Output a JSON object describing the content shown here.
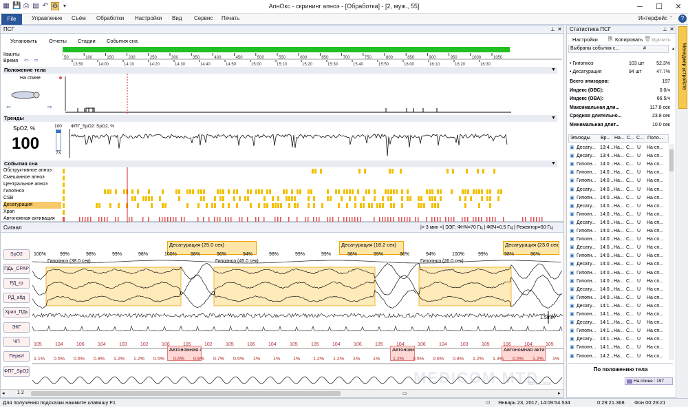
{
  "window": {
    "title": "АпнОкс - скрининг апноэ - [Обработка] - [2, муж., 55]",
    "minimize": "─",
    "maximize": "☐",
    "close": "✕"
  },
  "menu": {
    "file": "File",
    "items": [
      "Управление",
      "Съём",
      "Обработки",
      "Настройки",
      "Вид",
      "Сервис",
      "Печать"
    ],
    "interface_label": "Интерфейс",
    "help": "?"
  },
  "psg": {
    "title": "ПСГ",
    "tabs": [
      "Установить",
      "Отчеты",
      "Стадии",
      "События сна"
    ],
    "kvanty_label": "Кванты",
    "time_label": "Время",
    "stage_label": "Нет",
    "hour_ticks": [
      "13:50",
      "14:00",
      "14:10",
      "14:20",
      "14:30",
      "14:40",
      "14:50",
      "15:00",
      "15:10",
      "15:20",
      "15:30",
      "15:40",
      "15:50",
      "16:00",
      "16:10",
      "16:20",
      "16:30"
    ],
    "num_ticks": [
      "50",
      "100",
      "150",
      "200",
      "250",
      "300",
      "350",
      "400",
      "450",
      "500",
      "550",
      "600",
      "650",
      "700",
      "750",
      "800",
      "850",
      "900",
      "950",
      "1000",
      "1050"
    ],
    "position_section": "Положение тела",
    "position_value": "На спине",
    "trends_section": "Тренды",
    "spo2_label": "SpO2, %",
    "spo2_value": "100",
    "spo2_scale_top": "100",
    "spo2_scale_bottom": "73",
    "trend_title": "ФПГ_SpO2: SpO2, %",
    "events_section": "События сна",
    "event_rows": [
      "Обструктивное апноэ",
      "Смешанное апноэ",
      "Центральное апноэ",
      "Гипопноэ",
      "CSB",
      "Десатурация",
      "Храп",
      "Автономная активация"
    ]
  },
  "signal": {
    "title": "Сигнал",
    "status": "|> 3 мин <|   ЭЭГ: ФНЧ=70 Гц | ФВЧ=0.5 Гц | Режектор=50 Гц",
    "channels": [
      "SpO2",
      "ПДь_CPAP",
      "РД_гр",
      "РД_абд",
      "Храп_ПДь",
      "ЭКГ",
      "ЧП",
      "ПервИ",
      "ФПГ_SpO2"
    ],
    "desat": [
      "Десатурация (25.0 сек)",
      "Десатурация (18.2 сек)",
      "Десатурация (23.0 сек)"
    ],
    "hypo": [
      "Гипопноэ (38.0 сек)",
      "Гипопноэ (45.0 сек)",
      "Гипопноэ (26.0 сек)"
    ],
    "auton": [
      "Автономная ак",
      "Автономна",
      "Автономная актива"
    ],
    "cal": "1.5mm",
    "spo2_pcts": [
      "100%",
      "99%",
      "98%",
      "99%",
      "98%",
      "100%",
      "98%",
      "96%",
      "94%",
      "98%",
      "99%",
      "99%",
      "98%",
      "99%",
      "96%",
      "94%",
      "100%",
      "99%",
      "98%",
      "96%"
    ],
    "hr_vals": [
      "105",
      "104",
      "106",
      "104",
      "103",
      "102",
      "106",
      "105",
      "102",
      "105",
      "106",
      "104",
      "105",
      "105",
      "104",
      "106",
      "105",
      "104",
      "106",
      "104",
      "103",
      "105",
      "106",
      "104",
      "105"
    ],
    "pervi_vals": [
      "1.1%",
      "0.5%",
      "0.6%",
      "0.8%",
      "1.2%",
      "1.2%",
      "0.5%",
      "0.6%",
      "0.8%",
      "0.7%",
      "0.5%",
      "1%",
      "1%",
      "1%",
      "1.2%",
      "1.2%",
      "1%",
      "1%",
      "1.2%",
      "0.5%",
      "0.6%",
      "0.8%",
      "1.2%",
      "1.3%",
      "0.5%",
      "1.2%",
      "1%"
    ],
    "page": "1 2",
    "watermark": "MEDICOM MTD",
    "watermark_date": "Mar 12 2018"
  },
  "stats": {
    "title": "Статистика ПСГ",
    "btn_settings": "Настройки",
    "btn_copy": "Копировать",
    "btn_delete": "Удалить",
    "col_selected": "Выбраны события с...",
    "col_num": "#",
    "rows": [
      {
        "name": "Гипопноэ",
        "count": "103 шт",
        "pct": "52.3%"
      },
      {
        "name": "Десатурация",
        "count": "94 шт",
        "pct": "47.7%"
      }
    ],
    "summary": [
      {
        "label": "Всего эпизодов:",
        "value": "197"
      },
      {
        "label": "Индекс (ОВС):",
        "value": "0.0/ч"
      },
      {
        "label": "Индекс (ОВА):",
        "value": "66.5/ч"
      },
      {
        "label": "Максимальная дли...",
        "value": "117.8 сек"
      },
      {
        "label": "Средняя длительно...",
        "value": "23.8 сек"
      },
      {
        "label": "Минимальная длит...",
        "value": "10.0 сек"
      }
    ],
    "ep_cols": [
      "Эпизоды",
      "Вр...",
      "На...",
      "С...",
      "С...",
      "Поло..."
    ],
    "episodes": [
      {
        "name": "Десату...",
        "time": "13:4...",
        "na": "На...",
        "s1": "С...",
        "s2": "U",
        "pos": "На сп..."
      },
      {
        "name": "Десату...",
        "time": "13:4...",
        "na": "На...",
        "s1": "С...",
        "s2": "U",
        "pos": "На сп..."
      },
      {
        "name": "Гипопн...",
        "time": "14:0...",
        "na": "На...",
        "s1": "С...",
        "s2": "U",
        "pos": "На сп..."
      },
      {
        "name": "Гипопн...",
        "time": "14:0...",
        "na": "На...",
        "s1": "С...",
        "s2": "U",
        "pos": "На сп..."
      },
      {
        "name": "Гипопн...",
        "time": "14:0...",
        "na": "На...",
        "s1": "С...",
        "s2": "U",
        "pos": "На сп..."
      },
      {
        "name": "Десату...",
        "time": "14:0...",
        "na": "На...",
        "s1": "С...",
        "s2": "U",
        "pos": "На сп..."
      },
      {
        "name": "Гипопн...",
        "time": "14:0...",
        "na": "На...",
        "s1": "С...",
        "s2": "U",
        "pos": "На сп..."
      },
      {
        "name": "Десату...",
        "time": "14:0...",
        "na": "На...",
        "s1": "С...",
        "s2": "U",
        "pos": "На сп..."
      },
      {
        "name": "Гипопн...",
        "time": "14:0...",
        "na": "На...",
        "s1": "С...",
        "s2": "U",
        "pos": "На сп..."
      },
      {
        "name": "Десату...",
        "time": "14:0...",
        "na": "На...",
        "s1": "С...",
        "s2": "U",
        "pos": "На сп..."
      },
      {
        "name": "Гипопн...",
        "time": "14:0...",
        "na": "На...",
        "s1": "С...",
        "s2": "U",
        "pos": "На сп..."
      },
      {
        "name": "Гипопн...",
        "time": "14:0...",
        "na": "На...",
        "s1": "С...",
        "s2": "U",
        "pos": "На сп..."
      },
      {
        "name": "Десату...",
        "time": "14:0...",
        "na": "На...",
        "s1": "С...",
        "s2": "U",
        "pos": "На сп..."
      },
      {
        "name": "Гипопн...",
        "time": "14:0...",
        "na": "На...",
        "s1": "С...",
        "s2": "U",
        "pos": "На сп..."
      },
      {
        "name": "Десату...",
        "time": "14:0...",
        "na": "На...",
        "s1": "С...",
        "s2": "U",
        "pos": "На сп..."
      },
      {
        "name": "Гипопн...",
        "time": "14:0...",
        "na": "На...",
        "s1": "С...",
        "s2": "U",
        "pos": "На сп..."
      },
      {
        "name": "Гипопн...",
        "time": "14:0...",
        "na": "На...",
        "s1": "С...",
        "s2": "U",
        "pos": "На сп..."
      },
      {
        "name": "Десату...",
        "time": "14:0...",
        "na": "На...",
        "s1": "С...",
        "s2": "U",
        "pos": "На сп..."
      },
      {
        "name": "Гипопн...",
        "time": "14:0...",
        "na": "На...",
        "s1": "С...",
        "s2": "U",
        "pos": "На сп..."
      },
      {
        "name": "Десату...",
        "time": "14:1...",
        "na": "На...",
        "s1": "С...",
        "s2": "U",
        "pos": "На сп..."
      },
      {
        "name": "Гипопн...",
        "time": "14:1...",
        "na": "На...",
        "s1": "С...",
        "s2": "U",
        "pos": "На сп..."
      },
      {
        "name": "Десату...",
        "time": "14:1...",
        "na": "На...",
        "s1": "С...",
        "s2": "U",
        "pos": "На сп..."
      },
      {
        "name": "Гипопн...",
        "time": "14:1...",
        "na": "На...",
        "s1": "С...",
        "s2": "U",
        "pos": "На сп..."
      },
      {
        "name": "Десату...",
        "time": "14:1...",
        "na": "На...",
        "s1": "С...",
        "s2": "U",
        "pos": "На сп..."
      },
      {
        "name": "Гипопн...",
        "time": "14:1...",
        "na": "На...",
        "s1": "С...",
        "s2": "U",
        "pos": "На сп..."
      },
      {
        "name": "Гипопн...",
        "time": "14:2...",
        "na": "На...",
        "s1": "С...",
        "s2": "U",
        "pos": "На сп..."
      }
    ],
    "by_position_title": "По положению тела",
    "by_position_value": "На спине : 197"
  },
  "side_tab": "Менеджер устройств",
  "status": {
    "hint": "Для получения подсказки нажмите клавишу F1",
    "date": "Январь 23, 2017, 14:09:54.534",
    "elapsed": "0:29:21.368",
    "bg": "Фон 00:29:21"
  },
  "colors": {
    "accent": "#2b579a",
    "event_yellow": "#f2c000",
    "annotation": "#ffe6a8",
    "desat_red": "#e05050",
    "stage_green": "#22c022"
  }
}
